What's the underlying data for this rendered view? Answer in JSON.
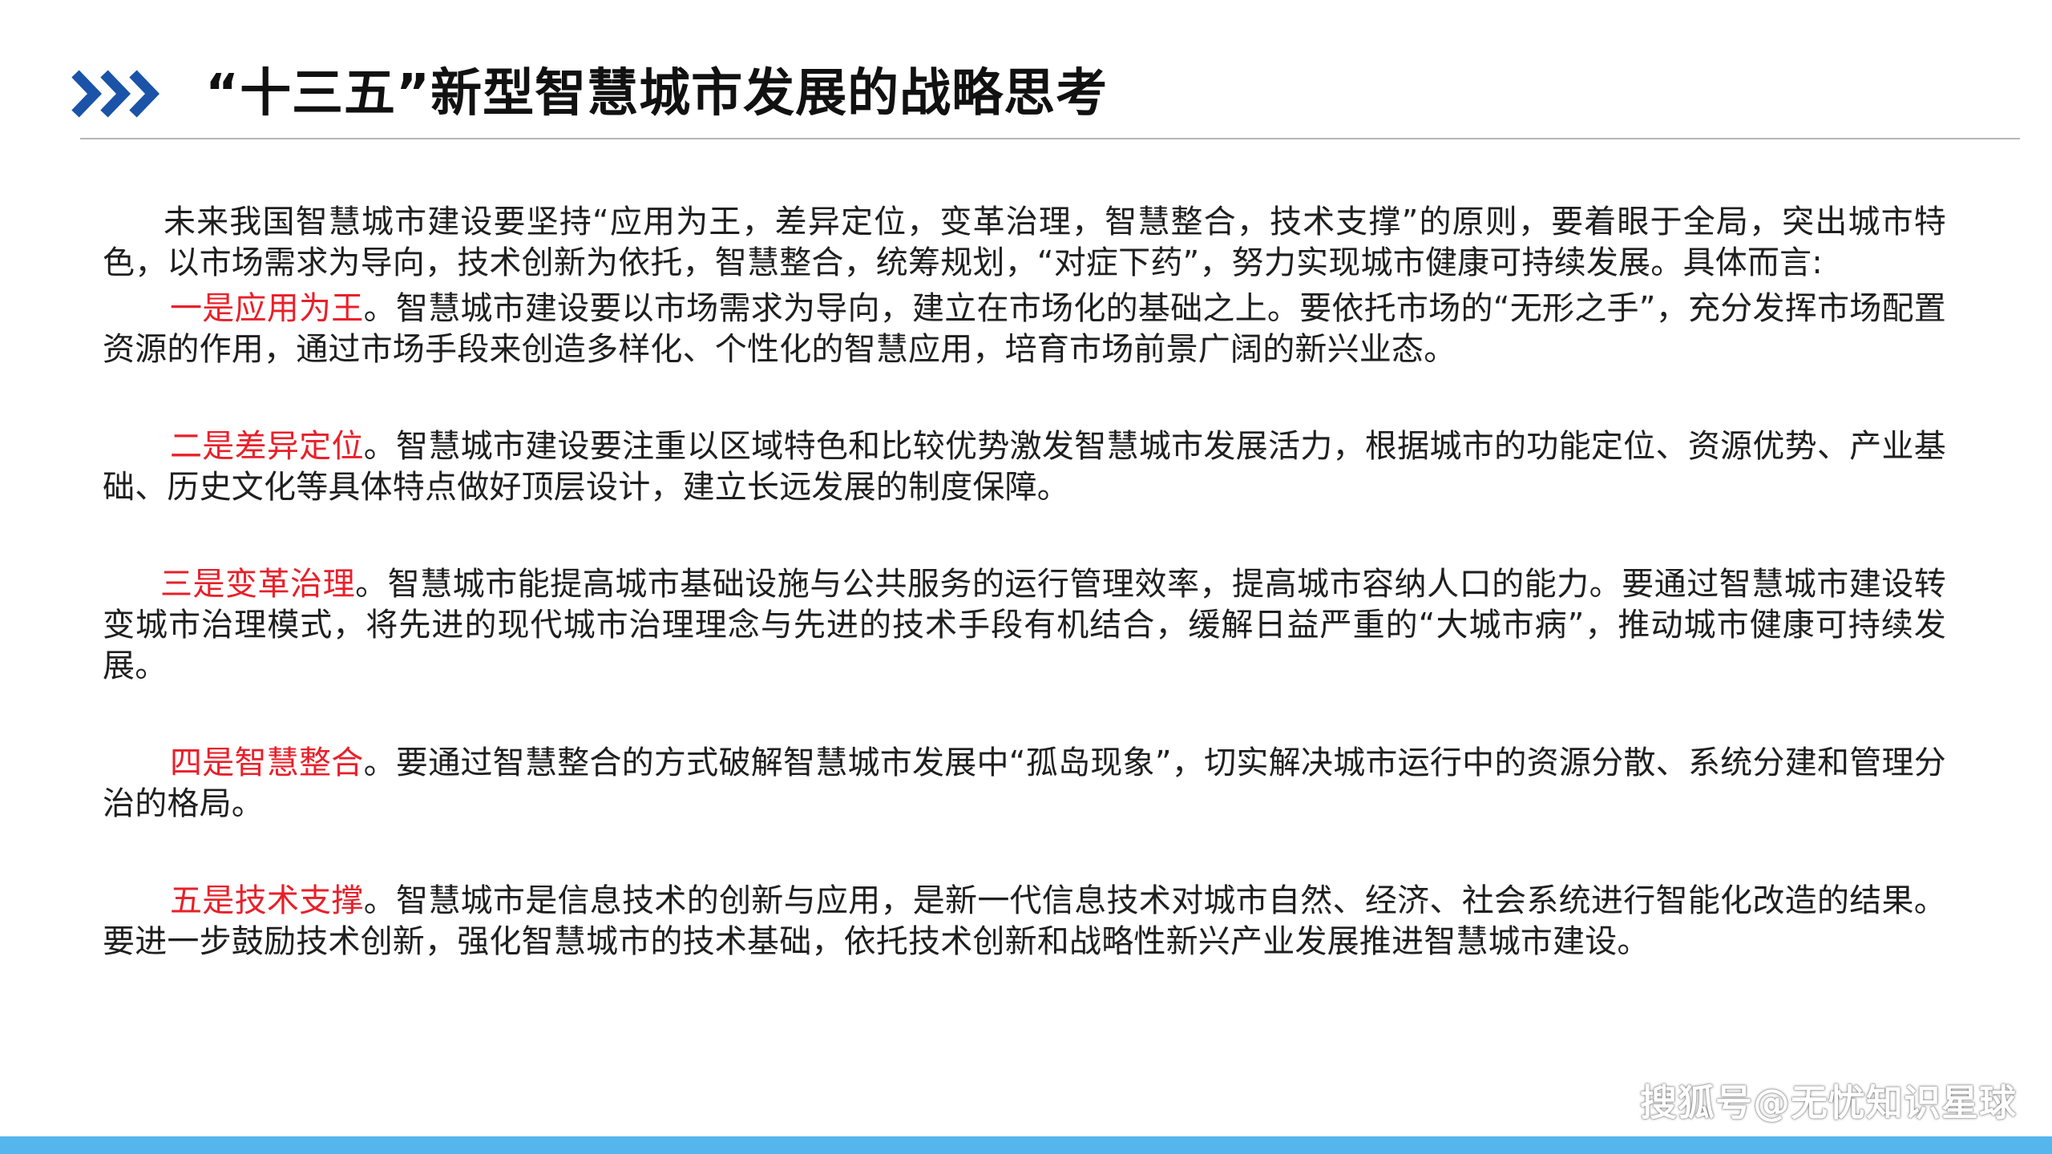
{
  "header": {
    "title": "“十三五”新型智慧城市发展的战略思考",
    "chevron_color": "#1a53a8"
  },
  "intro": "未来我国智慧城市建设要坚持“应用为王，差异定位，变革治理，智慧整合，技术支撑”的原则，要着眼于全局，突出城市特色，以市场需求为导向，技术创新为依托，智慧整合，统筹规划，“对症下药”，努力实现城市健康可持续发展。具体而言:",
  "points": [
    {
      "lead": "一是应用为王",
      "text": "。智慧城市建设要以市场需求为导向，建立在市场化的基础之上。要依托市场的“无形之手”，充分发挥市场配置资源的作用，通过市场手段来创造多样化、个性化的智慧应用，培育市场前景广阔的新兴业态。"
    },
    {
      "lead": "二是差异定位",
      "text": "。智慧城市建设要注重以区域特色和比较优势激发智慧城市发展活力，根据城市的功能定位、资源优势、产业基础、历史文化等具体特点做好顶层设计，建立长远发展的制度保障。"
    },
    {
      "lead": "三是变革治理",
      "text": "。智慧城市能提高城市基础设施与公共服务的运行管理效率，提高城市容纳人口的能力。要通过智慧城市建设转变城市治理模式，将先进的现代城市治理理念与先进的技术手段有机结合，缓解日益严重的“大城市病”，推动城市健康可持续发展。"
    },
    {
      "lead": "四是智慧整合",
      "text": "。要通过智慧整合的方式破解智慧城市发展中“孤岛现象”，切实解决城市运行中的资源分散、系统分建和管理分治的格局。"
    },
    {
      "lead": "五是技术支撑",
      "text": "。智慧城市是信息技术的创新与应用，是新一代信息技术对城市自然、经济、社会系统进行智能化改造的结果。要进一步鼓励技术创新，强化智慧城市的技术基础，依托技术创新和战略性新兴产业发展推进智慧城市建设。"
    }
  ],
  "watermark": "搜狐号@无忧知识星球",
  "colors": {
    "accent_red": "#e8202a",
    "bottom_bar": "#55b6ee"
  }
}
